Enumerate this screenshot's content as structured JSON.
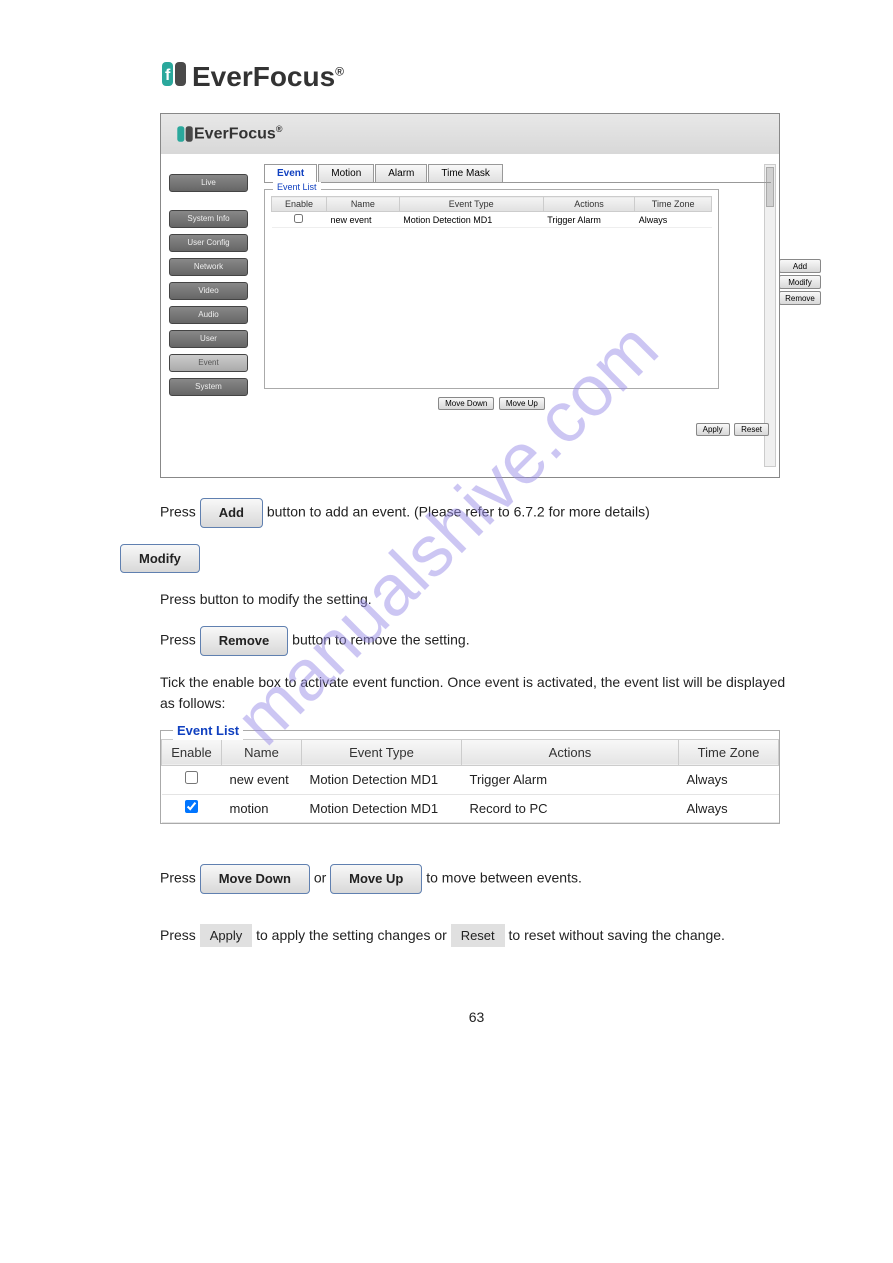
{
  "brand": "EverFocus",
  "registered": "®",
  "watermark": "manualshive.com",
  "app": {
    "sidebar": {
      "live": "Live",
      "items": [
        "System Info",
        "User Config",
        "Network",
        "Video",
        "Audio",
        "User",
        "Event",
        "System"
      ]
    },
    "tabs": [
      "Event",
      "Motion",
      "Alarm",
      "Time Mask"
    ],
    "event_list_title": "Event List",
    "columns": {
      "enable": "Enable",
      "name": "Name",
      "event_type": "Event Type",
      "actions": "Actions",
      "time_zone": "Time Zone"
    },
    "rows": [
      {
        "enable": false,
        "name": "new event",
        "event_type": "Motion Detection MD1",
        "actions": "Trigger Alarm",
        "time_zone": "Always"
      }
    ],
    "buttons": {
      "add": "Add",
      "modify": "Modify",
      "remove": "Remove",
      "move_down": "Move Down",
      "move_up": "Move Up",
      "apply": "Apply",
      "reset": "Reset"
    }
  },
  "doc": {
    "add_prefix": "Press",
    "add_suffix": "button to add an event. (Please refer to 6.7.2 for more details)",
    "modify_prefix": "Press",
    "modify_suffix": "button to modify the setting.",
    "remove_prefix": "Press",
    "remove_suffix": "button to remove the setting.",
    "enable_text": "Tick the enable box to activate event function. Once event is activated, the event list will be displayed as follows:",
    "panel_title": "Event List",
    "panel_columns": {
      "enable": "Enable",
      "name": "Name",
      "event_type": "Event Type",
      "actions": "Actions",
      "time_zone": "Time Zone"
    },
    "panel_rows": [
      {
        "enable": false,
        "name": "new event",
        "event_type": "Motion Detection MD1",
        "actions": "Trigger Alarm",
        "time_zone": "Always"
      },
      {
        "enable": true,
        "name": "motion",
        "event_type": "Motion Detection MD1",
        "actions": "Record to PC",
        "time_zone": "Always"
      }
    ],
    "move_label": "Press",
    "move_down": "Move Down",
    "move_or": "or",
    "move_up": "Move Up",
    "move_suffix": "to move between events.",
    "apply_prefix": "Press",
    "apply_label": "Apply",
    "apply_mid": "to apply the setting changes or",
    "reset_label": "Reset",
    "reset_suffix": "to reset without saving the change.",
    "page_number": "63"
  }
}
